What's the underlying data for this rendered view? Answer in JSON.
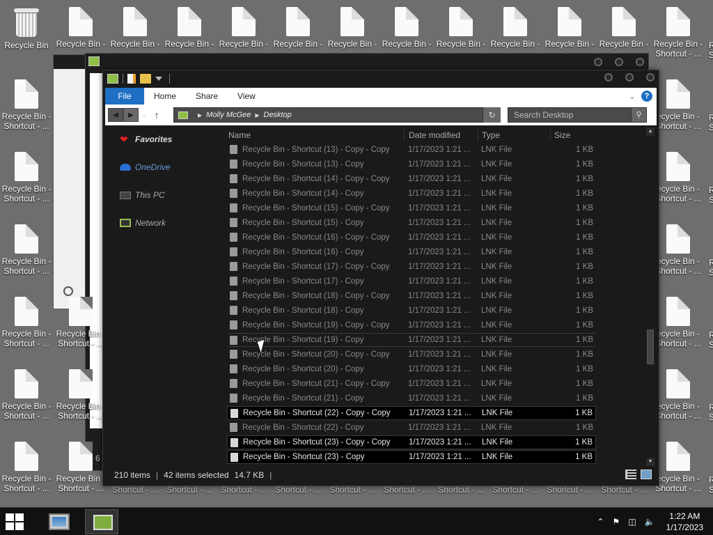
{
  "desktop": {
    "recycle_bin_label": "Recycle Bin",
    "top_row_label": "Recycle Bin -",
    "shortcut_line1": "Recycle Bin -",
    "shortcut_line2": "Shortcut - ...",
    "right_col_line1": "ecycle Bin -",
    "bottom_line2": "Shortcut - ...",
    "edge_letter": "R",
    "edge_letter2": "S"
  },
  "explorer": {
    "ribbon": {
      "file": "File",
      "home": "Home",
      "share": "Share",
      "view": "View",
      "help": "?"
    },
    "address": {
      "user": "Molly McGee",
      "folder": "Desktop"
    },
    "search_placeholder": "Search Desktop",
    "nav": {
      "favorites": "Favorites",
      "onedrive": "OneDrive",
      "thispc": "This PC",
      "network": "Network"
    },
    "columns": {
      "name": "Name",
      "date": "Date modified",
      "type": "Type",
      "size": "Size"
    },
    "files": [
      {
        "name": "Recycle Bin - Shortcut (13) - Copy - Copy",
        "date": "1/17/2023 1:21 ...",
        "type": "LNK File",
        "size": "1 KB"
      },
      {
        "name": "Recycle Bin - Shortcut (13) - Copy",
        "date": "1/17/2023 1:21 ...",
        "type": "LNK File",
        "size": "1 KB"
      },
      {
        "name": "Recycle Bin - Shortcut (14) - Copy - Copy",
        "date": "1/17/2023 1:21 ...",
        "type": "LNK File",
        "size": "1 KB"
      },
      {
        "name": "Recycle Bin - Shortcut (14) - Copy",
        "date": "1/17/2023 1:21 ...",
        "type": "LNK File",
        "size": "1 KB"
      },
      {
        "name": "Recycle Bin - Shortcut (15) - Copy - Copy",
        "date": "1/17/2023 1:21 ...",
        "type": "LNK File",
        "size": "1 KB"
      },
      {
        "name": "Recycle Bin - Shortcut (15) - Copy",
        "date": "1/17/2023 1:21 ...",
        "type": "LNK File",
        "size": "1 KB"
      },
      {
        "name": "Recycle Bin - Shortcut (16) - Copy - Copy",
        "date": "1/17/2023 1:21 ...",
        "type": "LNK File",
        "size": "1 KB"
      },
      {
        "name": "Recycle Bin - Shortcut (16) - Copy",
        "date": "1/17/2023 1:21 ...",
        "type": "LNK File",
        "size": "1 KB"
      },
      {
        "name": "Recycle Bin - Shortcut (17) - Copy - Copy",
        "date": "1/17/2023 1:21 ...",
        "type": "LNK File",
        "size": "1 KB"
      },
      {
        "name": "Recycle Bin - Shortcut (17) - Copy",
        "date": "1/17/2023 1:21 ...",
        "type": "LNK File",
        "size": "1 KB"
      },
      {
        "name": "Recycle Bin - Shortcut (18) - Copy - Copy",
        "date": "1/17/2023 1:21 ...",
        "type": "LNK File",
        "size": "1 KB"
      },
      {
        "name": "Recycle Bin - Shortcut (18) - Copy",
        "date": "1/17/2023 1:21 ...",
        "type": "LNK File",
        "size": "1 KB"
      },
      {
        "name": "Recycle Bin - Shortcut (19) - Copy - Copy",
        "date": "1/17/2023 1:21 ...",
        "type": "LNK File",
        "size": "1 KB"
      },
      {
        "name": "Recycle Bin - Shortcut (19) - Copy",
        "date": "1/17/2023 1:21 ...",
        "type": "LNK File",
        "size": "1 KB"
      },
      {
        "name": "Recycle Bin - Shortcut (20) - Copy - Copy",
        "date": "1/17/2023 1:21 ...",
        "type": "LNK File",
        "size": "1 KB"
      },
      {
        "name": "Recycle Bin - Shortcut (20) - Copy",
        "date": "1/17/2023 1:21 ...",
        "type": "LNK File",
        "size": "1 KB"
      },
      {
        "name": "Recycle Bin - Shortcut (21) - Copy - Copy",
        "date": "1/17/2023 1:21 ...",
        "type": "LNK File",
        "size": "1 KB"
      },
      {
        "name": "Recycle Bin - Shortcut (21) - Copy",
        "date": "1/17/2023 1:21 ...",
        "type": "LNK File",
        "size": "1 KB"
      },
      {
        "name": "Recycle Bin - Shortcut (22) - Copy - Copy",
        "date": "1/17/2023 1:21 ...",
        "type": "LNK File",
        "size": "1 KB"
      },
      {
        "name": "Recycle Bin - Shortcut (22) - Copy",
        "date": "1/17/2023 1:21 ...",
        "type": "LNK File",
        "size": "1 KB"
      },
      {
        "name": "Recycle Bin - Shortcut (23) - Copy - Copy",
        "date": "1/17/2023 1:21 ...",
        "type": "LNK File",
        "size": "1 KB"
      },
      {
        "name": "Recycle Bin - Shortcut (23) - Copy",
        "date": "1/17/2023 1:21 ...",
        "type": "LNK File",
        "size": "1 KB"
      }
    ],
    "status": {
      "count": "210 items",
      "selected": "42 items selected",
      "size": "14.7 KB"
    }
  },
  "taskbar": {
    "time": "1:22 AM",
    "date": "1/17/2023"
  },
  "background_window": {
    "digit": "6"
  }
}
